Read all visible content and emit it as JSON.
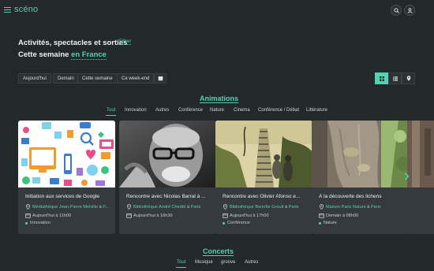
{
  "header": {
    "logo": "scéno",
    "icons": [
      "menu-icon",
      "search-icon",
      "user-icon"
    ]
  },
  "intro": {
    "headline": "Activités, spectacles et sorties",
    "filter_label": "Filtrer",
    "period": "Cette semaine",
    "location": "en France"
  },
  "date_filters": [
    "Aujourd'hui",
    "Demain",
    "Cette semaine",
    "Ce week-end"
  ],
  "views": [
    "grid-view-icon",
    "list-view-icon",
    "map-view-icon"
  ],
  "animations": {
    "title": "Animations",
    "tabs": [
      "Tout",
      "Innovation",
      "Autres",
      "Conférence",
      "Nature",
      "Cinema",
      "Conférence / Débat",
      "Littérature"
    ],
    "active_tab": "Tout",
    "cards": [
      {
        "title": "Initiation aux services de Google",
        "venue": "Médiathèque Jean-Pierre Melville",
        "sep": "à",
        "city": "P...",
        "when": "Aujourd'hui à 11h00",
        "category": "Innovation"
      },
      {
        "title": "Rencontre avec Nicolas Barral à ...",
        "venue": "Bibliothèque André Chedid",
        "sep": "à",
        "city": "Paris",
        "when": "Aujourd'hui à 16h30",
        "category": ""
      },
      {
        "title": "Rencontre avec Olivier Afonso e...",
        "venue": "Bibliothèque Benoîte Groult",
        "sep": "à",
        "city": "Paris",
        "when": "Aujourd'hui à 17h00",
        "category": "Conférence"
      },
      {
        "title": "À la découverte des lichens",
        "venue": "Maison Paris Nature",
        "sep": "à",
        "city": "Paris",
        "when": "Demain à 08h00",
        "category": "Nature"
      }
    ]
  },
  "concerts": {
    "title": "Concerts",
    "tabs": [
      "Tout",
      "Musique",
      "groove",
      "Autres"
    ],
    "active_tab": "Tout"
  },
  "colors": {
    "accent": "#4fd3b4",
    "background": "#23282b",
    "card": "#343a3e"
  }
}
